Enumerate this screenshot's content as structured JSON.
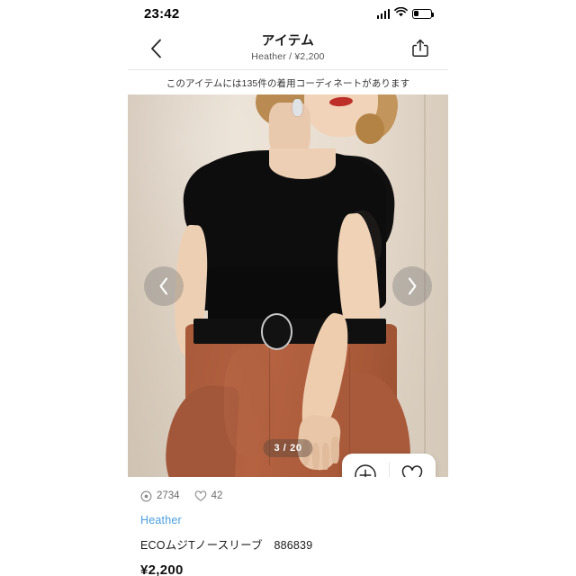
{
  "status_bar": {
    "time": "23:42",
    "signal_icon": "signal-bars-icon",
    "wifi_icon": "wifi-icon",
    "battery_icon": "battery-low-icon"
  },
  "nav": {
    "back_icon": "chevron-left-icon",
    "title": "アイテム",
    "subtitle": "Heather / ¥2,200",
    "share_icon": "share-icon"
  },
  "banner": {
    "text": "このアイテムには135件の着用コーディネートがあります",
    "count": "135"
  },
  "carousel": {
    "prev_icon": "chevron-left-icon",
    "next_icon": "chevron-right-icon",
    "counter": "3 / 20",
    "current_index": "3",
    "total": "20",
    "image_alt": "black-sleeveless-top-terracotta-skirt-photo"
  },
  "floating_actions": {
    "add_icon": "plus-circle-icon",
    "like_icon": "heart-outline-icon"
  },
  "stats": {
    "views_icon": "view-count-icon",
    "views": "2734",
    "likes_icon": "heart-outline-icon",
    "likes": "42"
  },
  "product": {
    "brand": "Heather",
    "name": "ECOムジTノースリーブ　886839",
    "price": "¥2,200"
  },
  "colors": {
    "link_blue": "#4a9fe0",
    "text_primary": "#1c1c1c",
    "text_muted": "#6b6b6b",
    "skirt_terracotta": "#b0603f",
    "top_black": "#0e0d0d",
    "wall_beige": "#e8ded2"
  }
}
